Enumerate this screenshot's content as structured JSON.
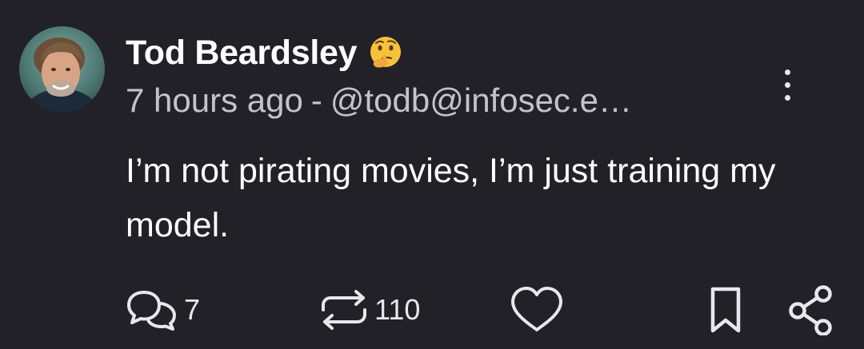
{
  "post": {
    "author": {
      "display_name": "Tod Beardsley",
      "handle": "@todb@infosec.e…",
      "name_emoji": "thinking-face-emoji"
    },
    "time": "7 hours ago",
    "separator": "-",
    "text": "I’m not pirating movies, I’m just training my model.",
    "actions": {
      "replies": "7",
      "boosts": "110"
    }
  },
  "colors": {
    "background": "#232128",
    "text": "#ffffff",
    "muted": "#c4c2cc",
    "icon": "#e9e7ee"
  }
}
